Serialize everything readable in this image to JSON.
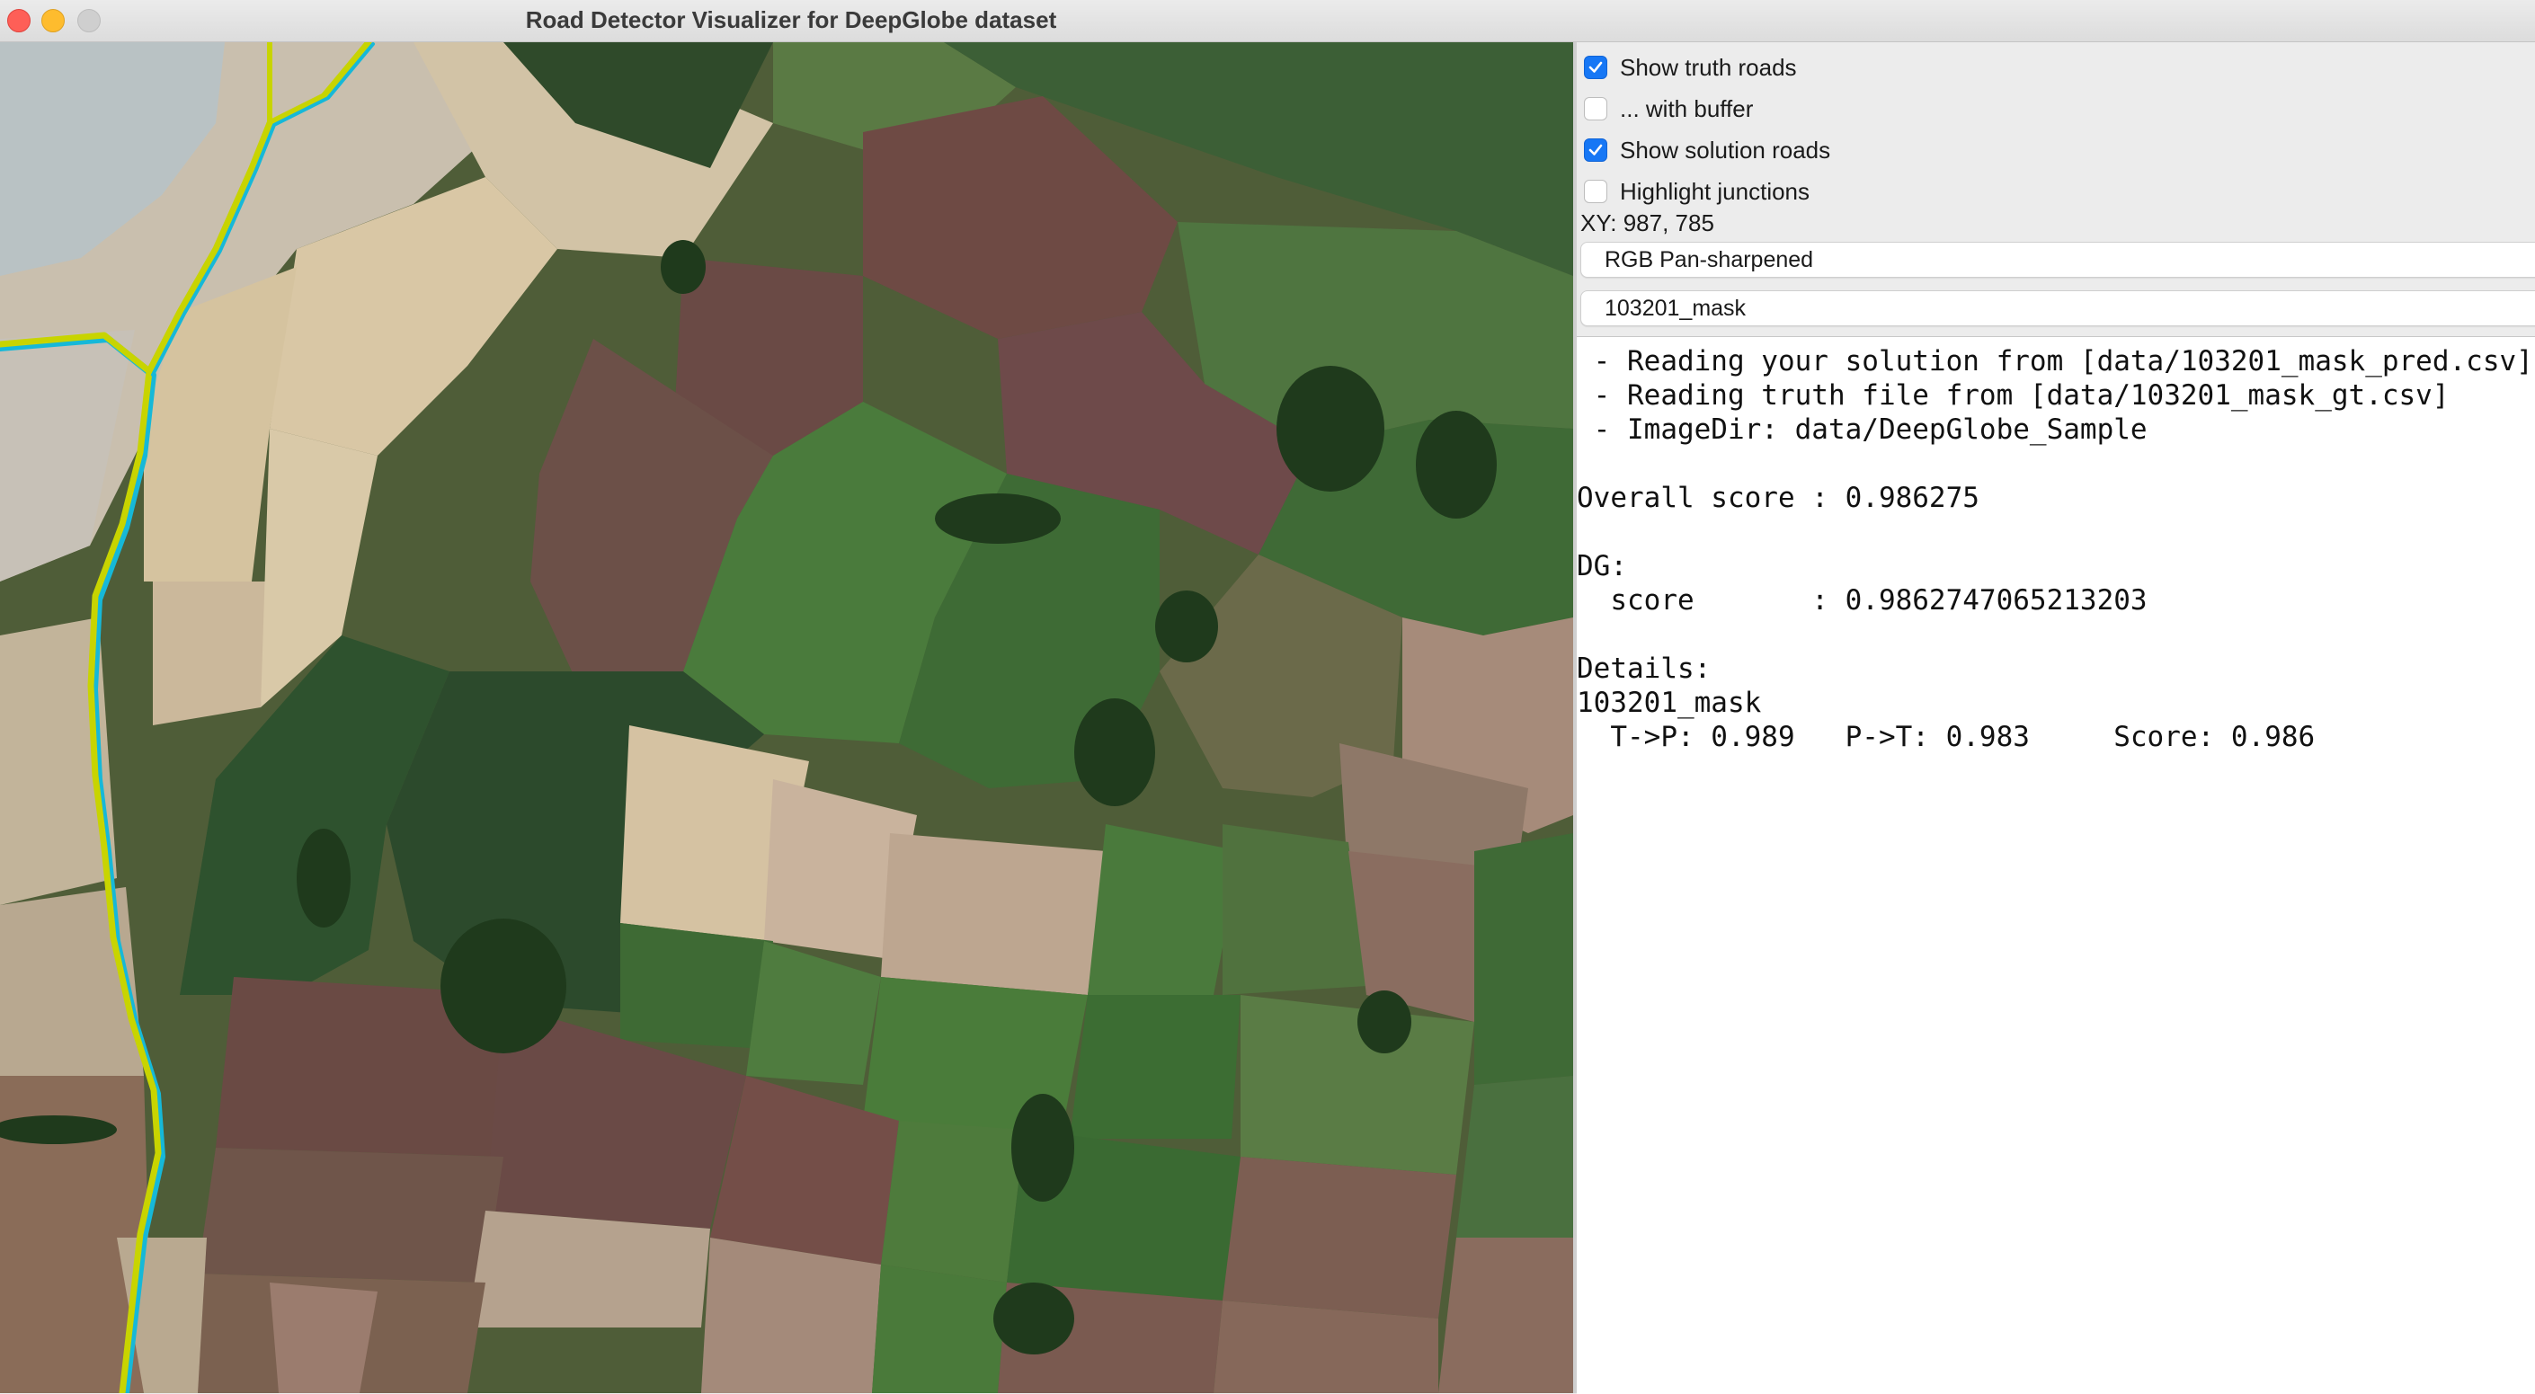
{
  "window": {
    "title": "Road Detector Visualizer for DeepGlobe dataset"
  },
  "controls": {
    "show_truth_roads": {
      "label": "Show truth roads",
      "checked": true
    },
    "with_buffer": {
      "label": "... with buffer",
      "checked": false
    },
    "show_solution_roads": {
      "label": "Show solution roads",
      "checked": true
    },
    "highlight_junctions": {
      "label": "Highlight junctions",
      "checked": false
    }
  },
  "xy_readout": "XY: 987, 785",
  "image_mode_select": {
    "value": "RGB Pan-sharpened"
  },
  "image_select": {
    "value": "103201_mask"
  },
  "log": {
    "lines": [
      " - Reading your solution from [data/103201_mask_pred.csv]",
      " - Reading truth file from [data/103201_mask_gt.csv]",
      " - ImageDir: data/DeepGlobe_Sample",
      "",
      "Overall score : 0.986275",
      "",
      "DG:",
      "  score       : 0.9862747065213203",
      "",
      "Details:",
      "103201_mask",
      "  T->P: 0.989   P->T: 0.983     Score: 0.986"
    ]
  },
  "colors": {
    "checkbox_checked": "#1677f5",
    "truth_road": "#c8d400",
    "solution_road": "#16b8d8"
  }
}
